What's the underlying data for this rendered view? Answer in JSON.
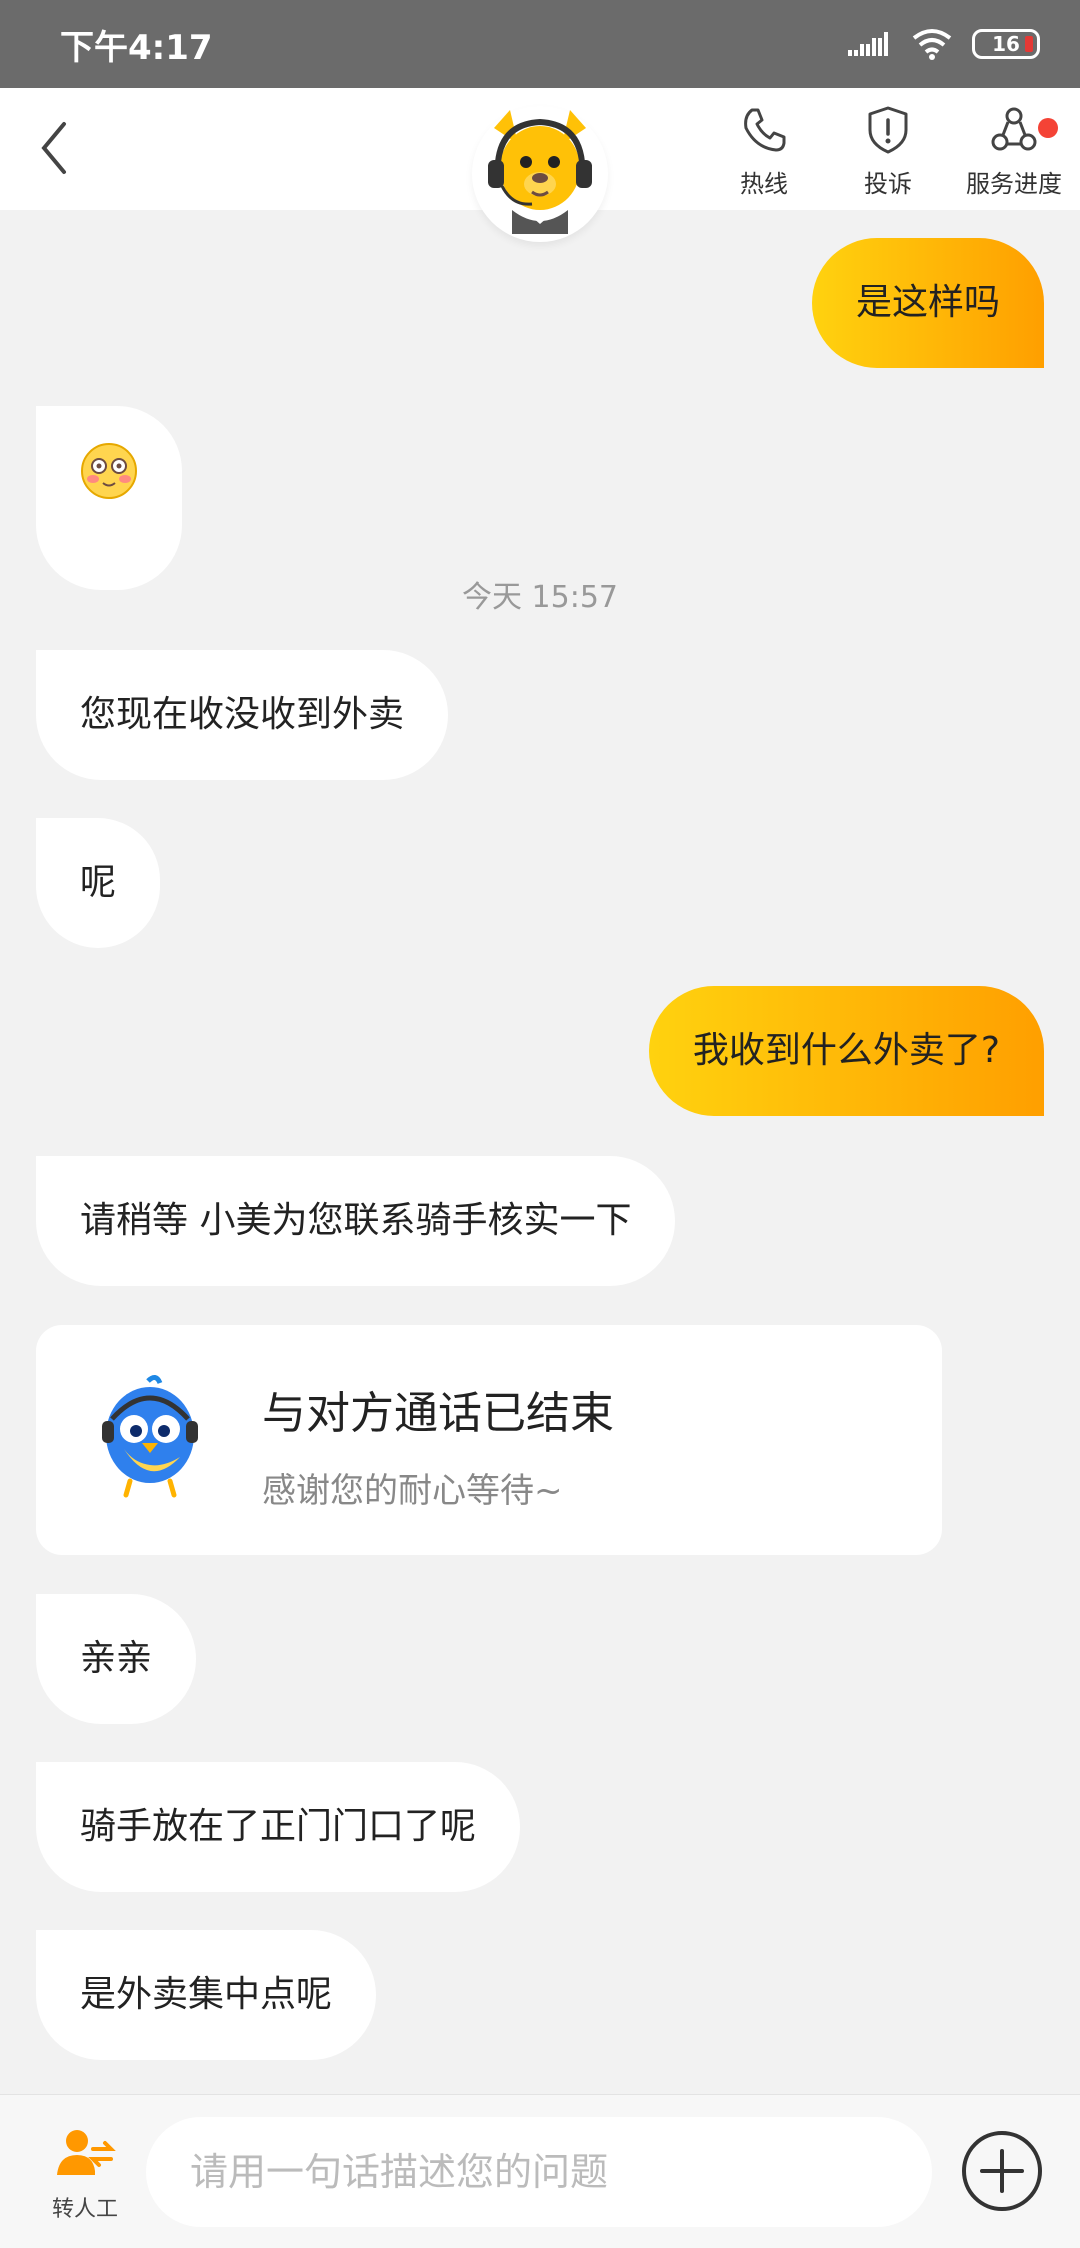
{
  "status_bar": {
    "time": "下午4:17",
    "battery": "16"
  },
  "header": {
    "back_icon": "chevron-left-icon",
    "avatar": "kangaroo-agent-avatar",
    "actions": [
      {
        "label": "热线",
        "icon": "phone-icon"
      },
      {
        "label": "投诉",
        "icon": "shield-alert-icon"
      },
      {
        "label": "服务进度",
        "icon": "progress-nodes-icon",
        "badge_dot": true
      }
    ]
  },
  "messages": [
    {
      "side": "right",
      "text": "是这样吗"
    },
    {
      "side": "left",
      "emoji": "blushing-face-emoji"
    },
    {
      "type": "timestamp",
      "text": "今天 15:57"
    },
    {
      "side": "left",
      "text": "您现在收没收到外卖"
    },
    {
      "side": "left",
      "text": "呢"
    },
    {
      "side": "right",
      "text": "我收到什么外卖了?"
    },
    {
      "side": "left",
      "text": "请稍等 小美为您联系骑手核实一下"
    },
    {
      "type": "card",
      "title": "与对方通话已结束",
      "subtitle": "感谢您的耐心等待~",
      "icon": "bird-mascot-icon"
    },
    {
      "side": "left",
      "text": "亲亲"
    },
    {
      "side": "left",
      "text": "骑手放在了正门门口了呢"
    },
    {
      "side": "left",
      "text": "是外卖集中点呢"
    }
  ],
  "input_bar": {
    "transfer_label": "转人工",
    "placeholder": "请用一句话描述您的问题",
    "plus_icon": "plus-circle-icon"
  },
  "colors": {
    "accent_start": "#ffd20f",
    "accent_end": "#ff9f00",
    "status_bar": "#6b6b6b",
    "badge": "#f44336"
  }
}
